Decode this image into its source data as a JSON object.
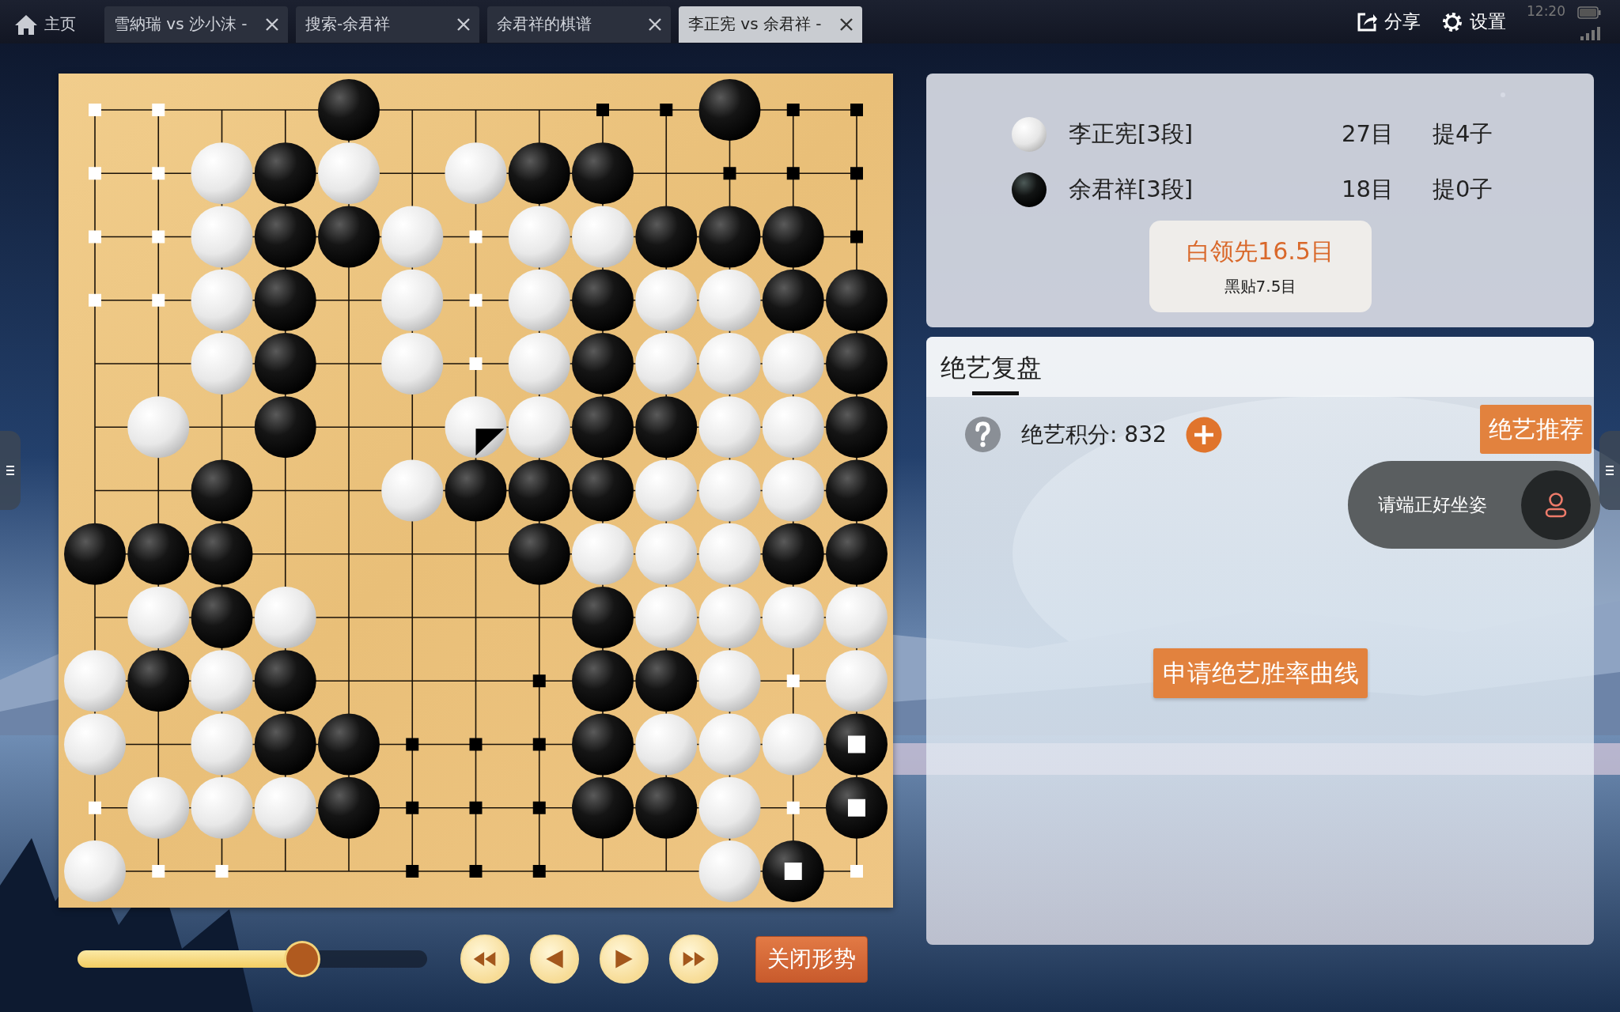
{
  "tabs": [
    {
      "label": "主页",
      "kind": "home",
      "selected": false
    },
    {
      "label": "雪納瑞 vs 沙小沫 -",
      "kind": "game",
      "selected": false
    },
    {
      "label": "搜索-余君祥",
      "kind": "game",
      "selected": false
    },
    {
      "label": "余君祥的棋谱",
      "kind": "game",
      "selected": false
    },
    {
      "label": "李正宪 vs 余君祥 -",
      "kind": "game",
      "selected": true
    }
  ],
  "toolbar": {
    "share": "分享",
    "settings": "设置",
    "time": "12:20"
  },
  "board": {
    "rows": [
      {
        "points": [
          {
            "kind": "white-point"
          },
          {
            "kind": "white-point"
          },
          {
            "kind": "empty"
          },
          {
            "kind": "empty"
          },
          {
            "kind": "black"
          },
          {
            "kind": "empty"
          },
          {
            "kind": "empty"
          },
          {
            "kind": "empty"
          },
          {
            "kind": "black-point"
          },
          {
            "kind": "black-point"
          },
          {
            "kind": "black"
          },
          {
            "kind": "black-point"
          },
          {
            "kind": "black-point"
          }
        ]
      },
      {
        "points": [
          {
            "kind": "white-point"
          },
          {
            "kind": "white-point"
          },
          {
            "kind": "white"
          },
          {
            "kind": "black"
          },
          {
            "kind": "white"
          },
          {
            "kind": "empty"
          },
          {
            "kind": "white"
          },
          {
            "kind": "black"
          },
          {
            "kind": "black"
          },
          {
            "kind": "empty"
          },
          {
            "kind": "black-point"
          },
          {
            "kind": "black-point"
          },
          {
            "kind": "black-point"
          }
        ]
      },
      {
        "points": [
          {
            "kind": "white-point"
          },
          {
            "kind": "white-point"
          },
          {
            "kind": "white"
          },
          {
            "kind": "black"
          },
          {
            "kind": "black"
          },
          {
            "kind": "white"
          },
          {
            "kind": "white-point"
          },
          {
            "kind": "white"
          },
          {
            "kind": "white"
          },
          {
            "kind": "black"
          },
          {
            "kind": "black"
          },
          {
            "kind": "black"
          },
          {
            "kind": "black-point"
          }
        ]
      },
      {
        "points": [
          {
            "kind": "white-point"
          },
          {
            "kind": "white-point"
          },
          {
            "kind": "white"
          },
          {
            "kind": "black"
          },
          {
            "kind": "empty"
          },
          {
            "kind": "white"
          },
          {
            "kind": "white-point"
          },
          {
            "kind": "white"
          },
          {
            "kind": "black"
          },
          {
            "kind": "white"
          },
          {
            "kind": "white"
          },
          {
            "kind": "black"
          },
          {
            "kind": "black"
          }
        ]
      },
      {
        "points": [
          {
            "kind": "empty"
          },
          {
            "kind": "empty"
          },
          {
            "kind": "white"
          },
          {
            "kind": "black"
          },
          {
            "kind": "empty"
          },
          {
            "kind": "white"
          },
          {
            "kind": "white-point"
          },
          {
            "kind": "white"
          },
          {
            "kind": "black"
          },
          {
            "kind": "white"
          },
          {
            "kind": "white"
          },
          {
            "kind": "white"
          },
          {
            "kind": "black"
          }
        ]
      },
      {
        "points": [
          {
            "kind": "empty"
          },
          {
            "kind": "white"
          },
          {
            "kind": "empty"
          },
          {
            "kind": "black"
          },
          {
            "kind": "empty"
          },
          {
            "kind": "empty"
          },
          {
            "kind": "last-white"
          },
          {
            "kind": "white"
          },
          {
            "kind": "black"
          },
          {
            "kind": "black"
          },
          {
            "kind": "white"
          },
          {
            "kind": "white"
          },
          {
            "kind": "black"
          }
        ]
      },
      {
        "points": [
          {
            "kind": "empty"
          },
          {
            "kind": "empty"
          },
          {
            "kind": "black"
          },
          {
            "kind": "empty"
          },
          {
            "kind": "empty"
          },
          {
            "kind": "white"
          },
          {
            "kind": "black"
          },
          {
            "kind": "black"
          },
          {
            "kind": "black"
          },
          {
            "kind": "white"
          },
          {
            "kind": "white"
          },
          {
            "kind": "white"
          },
          {
            "kind": "black"
          }
        ]
      },
      {
        "points": [
          {
            "kind": "black"
          },
          {
            "kind": "black"
          },
          {
            "kind": "black"
          },
          {
            "kind": "empty"
          },
          {
            "kind": "empty"
          },
          {
            "kind": "empty"
          },
          {
            "kind": "empty"
          },
          {
            "kind": "black"
          },
          {
            "kind": "white"
          },
          {
            "kind": "white"
          },
          {
            "kind": "white"
          },
          {
            "kind": "black"
          },
          {
            "kind": "black"
          }
        ]
      },
      {
        "points": [
          {
            "kind": "empty"
          },
          {
            "kind": "white"
          },
          {
            "kind": "black"
          },
          {
            "kind": "white"
          },
          {
            "kind": "empty"
          },
          {
            "kind": "empty"
          },
          {
            "kind": "empty"
          },
          {
            "kind": "empty"
          },
          {
            "kind": "black"
          },
          {
            "kind": "white"
          },
          {
            "kind": "white"
          },
          {
            "kind": "white"
          },
          {
            "kind": "white"
          }
        ]
      },
      {
        "points": [
          {
            "kind": "white"
          },
          {
            "kind": "black"
          },
          {
            "kind": "white"
          },
          {
            "kind": "black"
          },
          {
            "kind": "empty"
          },
          {
            "kind": "empty"
          },
          {
            "kind": "empty"
          },
          {
            "kind": "black-point"
          },
          {
            "kind": "black"
          },
          {
            "kind": "black"
          },
          {
            "kind": "white"
          },
          {
            "kind": "white-point"
          },
          {
            "kind": "white"
          }
        ]
      },
      {
        "points": [
          {
            "kind": "white"
          },
          {
            "kind": "empty"
          },
          {
            "kind": "white"
          },
          {
            "kind": "black"
          },
          {
            "kind": "black"
          },
          {
            "kind": "black-point"
          },
          {
            "kind": "black-point"
          },
          {
            "kind": "black-point"
          },
          {
            "kind": "black"
          },
          {
            "kind": "white"
          },
          {
            "kind": "white"
          },
          {
            "kind": "white"
          },
          {
            "kind": "dead-black"
          }
        ]
      },
      {
        "points": [
          {
            "kind": "white-point"
          },
          {
            "kind": "white"
          },
          {
            "kind": "white"
          },
          {
            "kind": "white"
          },
          {
            "kind": "black"
          },
          {
            "kind": "black-point"
          },
          {
            "kind": "black-point"
          },
          {
            "kind": "black-point"
          },
          {
            "kind": "black"
          },
          {
            "kind": "black"
          },
          {
            "kind": "white"
          },
          {
            "kind": "white-point"
          },
          {
            "kind": "dead-black"
          }
        ]
      },
      {
        "points": [
          {
            "kind": "white"
          },
          {
            "kind": "white-point"
          },
          {
            "kind": "white-point"
          },
          {
            "kind": "empty"
          },
          {
            "kind": "empty"
          },
          {
            "kind": "black-point"
          },
          {
            "kind": "black-point"
          },
          {
            "kind": "black-point"
          },
          {
            "kind": "empty"
          },
          {
            "kind": "empty"
          },
          {
            "kind": "white"
          },
          {
            "kind": "dead-black"
          },
          {
            "kind": "white-point"
          }
        ]
      }
    ]
  },
  "players": [
    {
      "name": "李正宪[3段]",
      "kind": "white",
      "score": "27目",
      "captures": "提4子"
    },
    {
      "name": "余君祥[3段]",
      "kind": "black",
      "score": "18目",
      "captures": "提0子"
    }
  ],
  "lead": {
    "text": "白领先16.5目",
    "komi": "黑贴7.5目"
  },
  "analysis": {
    "tabs": [
      {
        "label": "绝艺复盘",
        "selected": true
      }
    ],
    "points_label": "绝艺积分: 832",
    "recommend": "绝艺推荐",
    "winrate_button": "申请绝艺胜率曲线"
  },
  "toast": {
    "text": "请端正好坐姿"
  },
  "playback": {
    "level": 0.66,
    "buttons": [
      {
        "kind": "first"
      },
      {
        "kind": "prev"
      },
      {
        "kind": "next"
      },
      {
        "kind": "last"
      }
    ],
    "toggle": "关闭形势"
  }
}
